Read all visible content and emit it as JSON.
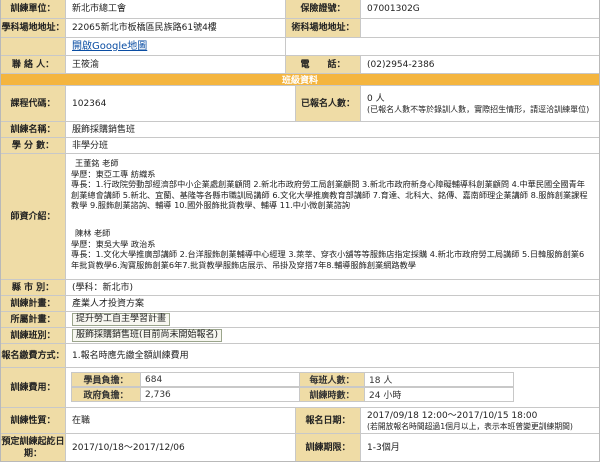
{
  "unit": {
    "label": "訓練單位：",
    "value": "新北市總工會",
    "cert_label": "保險證號：",
    "cert_value": "07001302G"
  },
  "address": {
    "label": "學科場地地址：",
    "value": "22065新北市板橋區民族路61號4樓",
    "tech_label": "術科場地地址：",
    "tech_value": "",
    "map_link": "開啟Google地圖"
  },
  "contact": {
    "label": "聯 絡 人：",
    "value": "王筱渝",
    "phone_label": "電　　話：",
    "phone_value": "(02)2954-2386"
  },
  "section_title": "班級資料",
  "course_code": {
    "label": "課程代碼：",
    "value": "102364",
    "enrolled_label": "已報名人數：",
    "enrolled_value": "0 人",
    "enrolled_note": "(已報名人數不等於錄訓人數，實際招生情形，請逕洽訓練單位)"
  },
  "course_name": {
    "label": "訓練名稱：",
    "value": "服飾採購銷售班"
  },
  "credit": {
    "label": "學 分 數：",
    "value": "非學分班"
  },
  "teachers": {
    "label": "師資介紹：",
    "t1": {
      "name": "王董銘 老師",
      "edu": "學歷：東亞工專 紡織系",
      "skill_label": "專長：",
      "skill": "1.行政院勞動部經濟部中小企業處創業顧問 2.新北市政府勞工局創業顧問 3.新北市政府新身心障礙輔導科創業顧問 4.中華民國全國青年創業總會講師 5.新北、宜蘭、基隆等各縣市職訓局講師 6.文化大學推廣教育部講師 7.育達、北科大、銘傳、嘉南師理企業講師 8.服飾創業課程教學 9.服飾創業諮詢、輔導 10.國外服飾批貨教學、輔導 11.中小微創業諮詢"
    },
    "t2": {
      "name": "陳林 老師",
      "edu": "學歷：東吳大學 政治系",
      "skill_label": "專長：",
      "skill": "1.文化大學推廣部講師 2.台洋服飾創業輔導中心經理 3.萊莘、穿衣小舖等等服飾店指定採購 4.新北市政府勞工局講師 5.日韓服飾創業6年批貨教學6.淘寶服飾創業6年7.批貨教學服飾店展示、吊掛及穿搭7年8.輔導服飾創業網路教學"
    }
  },
  "city": {
    "label": "縣 市 別：",
    "value": "(學科：新北市)"
  },
  "plan": {
    "label": "訓練計畫：",
    "value": "產業人才投資方案"
  },
  "plan_owner": {
    "label": "所屬計畫：",
    "value": "提升勞工自主學習計畫"
  },
  "class": {
    "label": "訓練班別：",
    "value": "服飾採購銷售班(目前尚未開始報名)"
  },
  "fee_method": {
    "label": "報名繳費方式：",
    "value": "1.報名時應先繳全額訓練費用"
  },
  "fee": {
    "label": "訓練費用：",
    "student_label": "學員負擔：",
    "student_value": "684",
    "gov_label": "政府負擔：",
    "gov_value": "2,736",
    "max_label": "每班人數：",
    "max_value": "18 人",
    "hours_label": "訓練時數：",
    "hours_value": "24 小時"
  },
  "nature": {
    "label": "訓練性質：",
    "value": "在職",
    "apply_label": "報名日期：",
    "apply_value": "2017/09/18 12:00～2017/10/15 18:00",
    "apply_note": "(若開放報名時間超過1個月以上，表示本班曾變更訓練期間)"
  },
  "period": {
    "label": "預定訓練起訖日期：",
    "value": "2017/10/18～2017/12/06",
    "duration_label": "訓練期限：",
    "duration_value": "1-3個月"
  }
}
